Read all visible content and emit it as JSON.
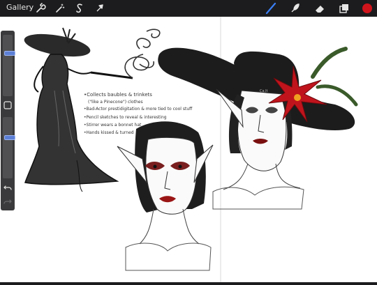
{
  "toolbar": {
    "gallery_label": "Gallery",
    "left_tools": [
      "wrench-icon",
      "magic-wand-icon",
      "selection-s-icon",
      "transform-arrow-icon"
    ],
    "right_tools": [
      "brush-icon",
      "smudge-icon",
      "eraser-icon",
      "layers-icon",
      "color-swatch"
    ],
    "active_tool": "brush-icon",
    "accent_color": "#3b7ff5",
    "current_color": "#d0141c"
  },
  "sidebar": {
    "brush_size_level": 0.72,
    "opacity_level": 0.68
  },
  "canvas": {
    "notes": [
      "•Collects baubles & trinkets",
      "(\"like a Pinecone\") clothes",
      "•Bad-Actor prestidigitation & more tied to cool stuff",
      "•Pencil sketches to reveal & interesting",
      "•Stirrer wears a bonnet hat",
      "•Hands kissed & turned"
    ]
  }
}
